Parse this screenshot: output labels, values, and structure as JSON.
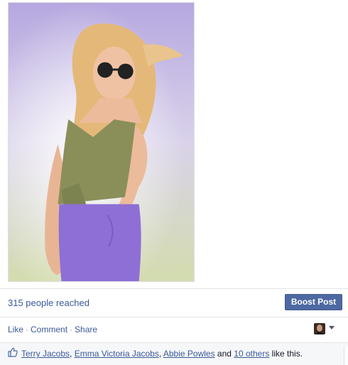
{
  "post": {
    "photo_alt": "fashion model photo"
  },
  "insights": {
    "reach_text": "315 people reached",
    "boost_label": "Boost Post"
  },
  "actions": {
    "like": "Like",
    "comment": "Comment",
    "share": "Share",
    "separator": "·"
  },
  "likes": {
    "icon": "thumbs-up-icon",
    "people": [
      "Terry Jacobs",
      "Emma Victoria Jacobs",
      "Abbie Powles"
    ],
    "sep1": ", ",
    "sep2": ", ",
    "and_text": " and ",
    "others": "10 others",
    "suffix": " like this."
  },
  "colors": {
    "link": "#3b5998",
    "boost_button": "#4e69a2",
    "likes_bar_bg": "#f6f7f9"
  }
}
